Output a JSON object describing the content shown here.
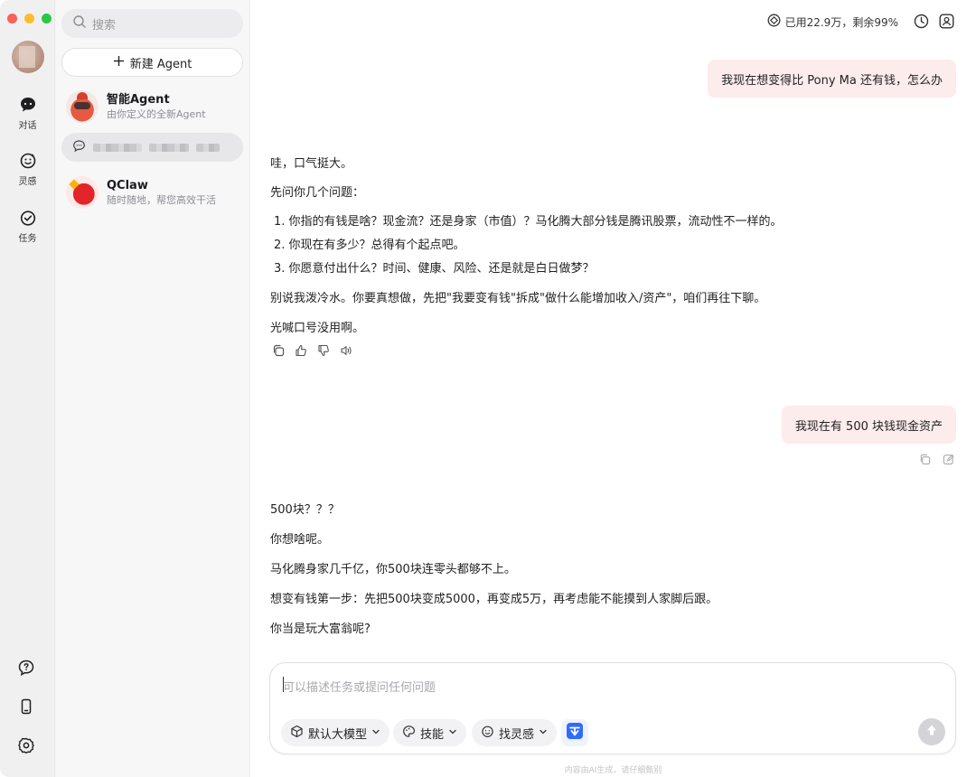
{
  "nav": {
    "items": [
      {
        "label": "对话",
        "icon": "chat-icon"
      },
      {
        "label": "灵感",
        "icon": "inspiration-icon"
      },
      {
        "label": "任务",
        "icon": "task-icon"
      }
    ]
  },
  "sidebar": {
    "search_placeholder": "搜索",
    "new_agent_label": "新建 Agent",
    "agents": [
      {
        "title": "智能Agent",
        "subtitle": "由你定义的全新Agent"
      },
      {
        "title": "QClaw",
        "subtitle": "随时随地，帮您高效干活"
      }
    ]
  },
  "header": {
    "usage_text": "已用22.9万，剩余99%"
  },
  "conversation": {
    "user_msg_1": "我现在想变得比 Pony Ma 还有钱，怎么办",
    "reply_1": {
      "p1": "哇，口气挺大。",
      "p2": "先问你几个问题：",
      "list": [
        "你指的有钱是啥？现金流？还是身家（市值）？马化腾大部分钱是腾讯股票，流动性不一样的。",
        "你现在有多少？总得有个起点吧。",
        "你愿意付出什么？时间、健康、风险、还是就是白日做梦？"
      ],
      "p3": "别说我泼冷水。你要真想做，先把\"我要变有钱\"拆成\"做什么能增加收入/资产\"，咱们再往下聊。",
      "p4": "光喊口号没用啊。"
    },
    "user_msg_2": "我现在有 500 块钱现金资产",
    "reply_2": {
      "p1": "500块？？？",
      "p2": "你想啥呢。",
      "p3": "马化腾身家几千亿，你500块连零头都够不上。",
      "p4": "想变有钱第一步：先把500块变成5000，再变成5万，再考虑能不能摸到人家脚后跟。",
      "p5": "你当是玩大富翁呢?"
    }
  },
  "composer": {
    "placeholder": "可以描述任务或提问任何问题",
    "model_label": "默认大模型",
    "skills_label": "技能",
    "inspiration_label": "找灵感"
  },
  "footer": {
    "note": "内容由AI生成，请仔细甄别"
  },
  "colors": {
    "user_bubble": "#fdecec",
    "sidebar_bg": "#f7f7f8",
    "rail_bg": "#f0f0f1"
  }
}
